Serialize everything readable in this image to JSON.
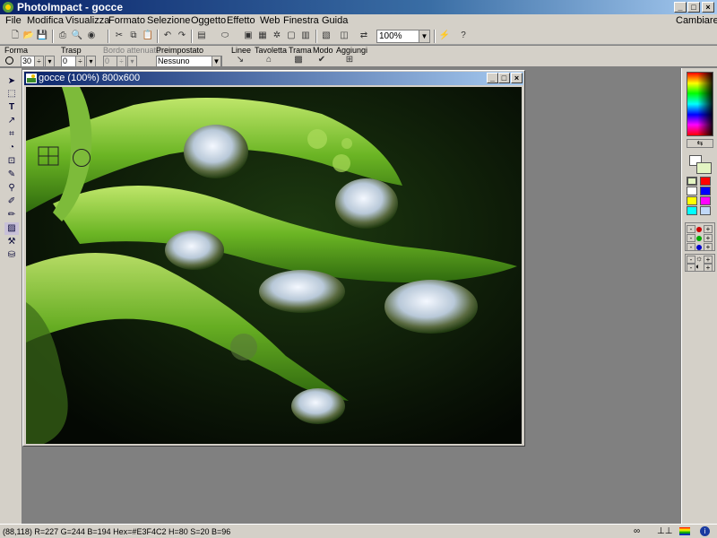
{
  "app": {
    "title": "PhotoImpact - gocce",
    "right_menu": "Cambiare"
  },
  "menu": [
    "File",
    "Modifica",
    "Visualizza",
    "Formato",
    "Selezione",
    "Oggetto",
    "Effetto",
    "Web",
    "Finestra",
    "Guida"
  ],
  "toolbar": {
    "zoom_value": "100%"
  },
  "options": {
    "forma_label": "Forma",
    "forma_value": "30",
    "trasp_label": "Trasp",
    "trasp_value": "0",
    "bordo_label": "Bordo attenuato",
    "bordo_value": "0",
    "preimpostato_label": "Preimpostato",
    "preimpostato_value": "Nessuno",
    "linee_label": "Linee",
    "tavoletta_label": "Tavoletta",
    "trama_label": "Trama",
    "modo_label": "Modo",
    "aggiungi_label": "Aggiungi"
  },
  "document": {
    "title": "gocce (100%) 800x600"
  },
  "status": {
    "text": "(88,118) R=227 G=244 B=194   Hex=#E3F4C2   H=80 S=20 B=96"
  },
  "colors": {
    "title_start": "#0a246a",
    "title_end": "#a6caf0",
    "foreground": "#E3F4C2",
    "face": "#d4d0c8"
  },
  "icons": [
    "arrow-icon",
    "select-icon",
    "text-icon",
    "transform-icon",
    "crop-icon",
    "path-icon",
    "clone-icon",
    "picker-icon",
    "zoom-icon",
    "paint-icon",
    "fill-icon",
    "eraser-icon",
    "retouch-icon",
    "stamp-icon"
  ]
}
